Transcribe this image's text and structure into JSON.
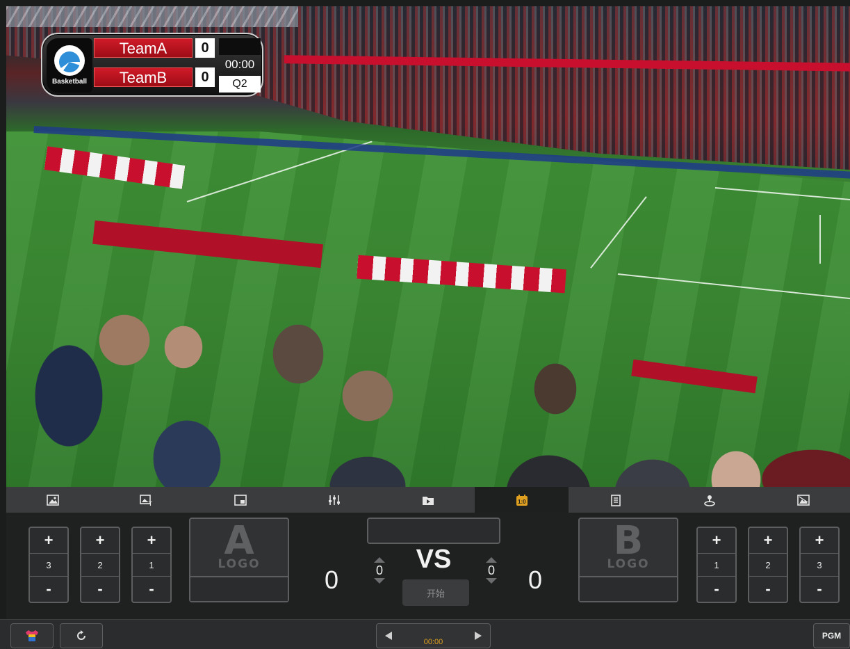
{
  "scoreboard": {
    "logo_text": "Basketball",
    "team_a": "TeamA",
    "team_b": "TeamB",
    "score_a": "0",
    "score_b": "0",
    "clock": "00:00",
    "period": "Q2"
  },
  "tabs": [
    {
      "icon": "image-icon"
    },
    {
      "icon": "image-text-icon"
    },
    {
      "icon": "picture-in-picture-icon"
    },
    {
      "icon": "mixer-icon"
    },
    {
      "icon": "folder-media-icon"
    },
    {
      "icon": "scoreboard-icon",
      "active": true,
      "label": "1:0"
    },
    {
      "icon": "notepad-icon"
    },
    {
      "icon": "joystick-icon"
    },
    {
      "icon": "image-swap-icon"
    }
  ],
  "team_a": {
    "logo_big": "A",
    "logo_small": "LOGO",
    "steppers": [
      {
        "plus": "+",
        "value": "3",
        "minus": "-"
      },
      {
        "plus": "+",
        "value": "2",
        "minus": "-"
      },
      {
        "plus": "+",
        "value": "1",
        "minus": "-"
      }
    ],
    "score": "0",
    "fouls": "0"
  },
  "team_b": {
    "logo_big": "B",
    "logo_small": "LOGO",
    "steppers": [
      {
        "plus": "+",
        "value": "1",
        "minus": "-"
      },
      {
        "plus": "+",
        "value": "2",
        "minus": "-"
      },
      {
        "plus": "+",
        "value": "3",
        "minus": "-"
      }
    ],
    "score": "0",
    "fouls": "0"
  },
  "center": {
    "vs": "VS",
    "start": "开始"
  },
  "bottombar": {
    "timer": "00:00",
    "pgm": "PGM"
  },
  "colors": {
    "accent": "#e0a020",
    "team_red": "#c8102e"
  }
}
